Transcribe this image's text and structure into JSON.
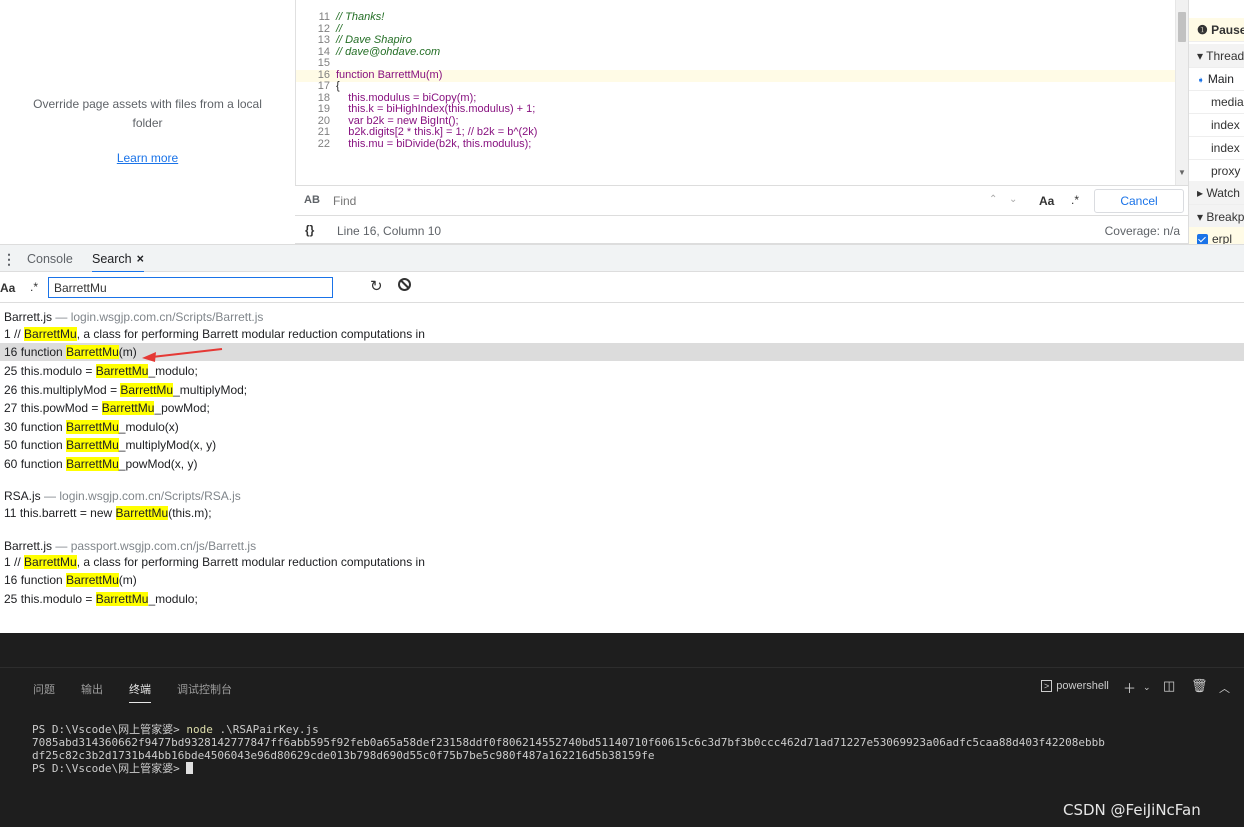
{
  "override_panel": {
    "message": "Override page assets with files from a local folder",
    "learn_more": "Learn more"
  },
  "editor": {
    "lines": [
      {
        "n": "11",
        "text": "// Thanks!"
      },
      {
        "n": "12",
        "text": "//"
      },
      {
        "n": "13",
        "text": "// Dave Shapiro"
      },
      {
        "n": "14",
        "text": "// dave@ohdave.com"
      },
      {
        "n": "15",
        "text": ""
      },
      {
        "n": "16",
        "text": "function BarrettMu(m)"
      },
      {
        "n": "17",
        "text": "{"
      },
      {
        "n": "18",
        "text": "    this.modulus = biCopy(m);"
      },
      {
        "n": "19",
        "text": "    this.k = biHighIndex(this.modulus) + 1;"
      },
      {
        "n": "20",
        "text": "    var b2k = new BigInt();"
      },
      {
        "n": "21",
        "text": "    b2k.digits[2 * this.k] = 1; // b2k = b^(2k)"
      },
      {
        "n": "22",
        "text": "    this.mu = biDivide(b2k, this.modulus);"
      }
    ]
  },
  "find_bar": {
    "icon": "AB",
    "placeholder": "Find",
    "case_label": "Aa",
    "regex_label": ".*",
    "cancel": "Cancel"
  },
  "status_bar": {
    "braces": "{}",
    "position": "Line 16, Column 10",
    "coverage": "Coverage: n/a"
  },
  "sidebar": {
    "paused": "Paused",
    "threads": "Threads",
    "main": "Main",
    "items": [
      "media",
      "index",
      "index",
      "proxy"
    ],
    "watch": "Watch",
    "breakpoints": "Breakpoints",
    "bp_item": "erpl"
  },
  "drawer": {
    "tabs": [
      "Console",
      "Search"
    ],
    "close": "×"
  },
  "search": {
    "case_label": "Aa",
    "regex_label": ".*",
    "query": "BarrettMu"
  },
  "results": [
    {
      "file": "Barrett.js",
      "path": "login.wsgjp.com.cn/Scripts/Barrett.js",
      "matches": [
        {
          "line": "1",
          "pre": "// ",
          "hit": "BarrettMu",
          "post": ", a class for performing Barrett modular reduction computations in"
        },
        {
          "line": "16",
          "pre": "function ",
          "hit": "BarrettMu",
          "post": "(m)"
        },
        {
          "line": "25",
          "pre": "this.modulo = ",
          "hit": "BarrettMu",
          "post": "_modulo;"
        },
        {
          "line": "26",
          "pre": "this.multiplyMod = ",
          "hit": "BarrettMu",
          "post": "_multiplyMod;"
        },
        {
          "line": "27",
          "pre": "this.powMod = ",
          "hit": "BarrettMu",
          "post": "_powMod;"
        },
        {
          "line": "30",
          "pre": "function ",
          "hit": "BarrettMu",
          "post": "_modulo(x)"
        },
        {
          "line": "50",
          "pre": "function ",
          "hit": "BarrettMu",
          "post": "_multiplyMod(x, y)"
        },
        {
          "line": "60",
          "pre": "function ",
          "hit": "BarrettMu",
          "post": "_powMod(x, y)"
        }
      ]
    },
    {
      "file": "RSA.js",
      "path": "login.wsgjp.com.cn/Scripts/RSA.js",
      "matches": [
        {
          "line": "11",
          "pre": "this.barrett = new ",
          "hit": "BarrettMu",
          "post": "(this.m);"
        }
      ]
    },
    {
      "file": "Barrett.js",
      "path": "passport.wsgjp.com.cn/js/Barrett.js",
      "matches": [
        {
          "line": "1",
          "pre": "// ",
          "hit": "BarrettMu",
          "post": ", a class for performing Barrett modular reduction computations in"
        },
        {
          "line": "16",
          "pre": "function ",
          "hit": "BarrettMu",
          "post": "(m)"
        },
        {
          "line": "25",
          "pre": "this.modulo = ",
          "hit": "BarrettMu",
          "post": "_modulo;"
        }
      ]
    }
  ],
  "terminal": {
    "tabs": [
      "问题",
      "输出",
      "终端",
      "调试控制台"
    ],
    "shell": "powershell",
    "prompt1": "PS D:\\Vscode\\网上管家婆> ",
    "cmd": "node",
    "args": " .\\RSAPairKey.js",
    "out1": "7085abd314360662f9477bd9328142777847ff6abb595f92feb0a65a58def23158ddf0f806214552740bd51140710f60615c6c3d7bf3b0ccc462d71ad71227e53069923a06adfc5caa88d403f42208ebbb",
    "out2": "df25c82c3b2d1731b44bb16bde4506043e96d80629cde013b798d690d55c0f75b7be5c980f487a162216d5b38159fe",
    "prompt2": "PS D:\\Vscode\\网上管家婆> "
  },
  "watermark": "CSDN @FeiJiNcFan"
}
